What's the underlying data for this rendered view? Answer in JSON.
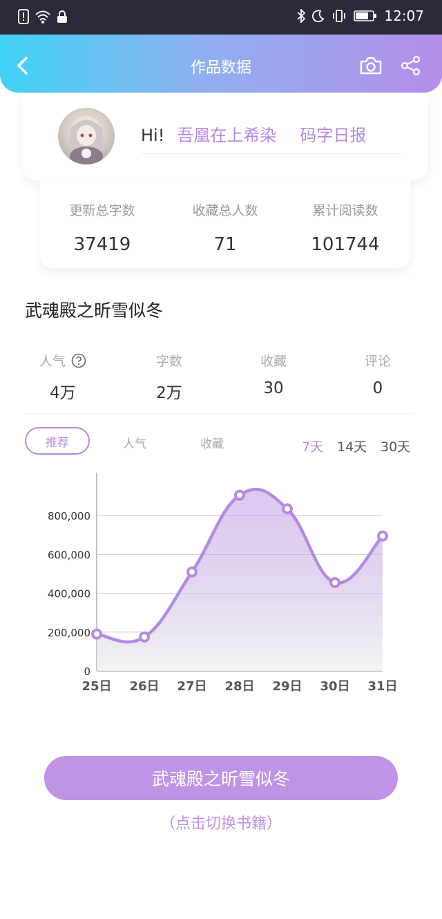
{
  "status_bar": {
    "time": "12:07",
    "icons": [
      "alert-icon",
      "wifi-icon",
      "lock-icon",
      "bluetooth-icon",
      "moon-icon",
      "vibrate-icon",
      "battery-icon"
    ]
  },
  "header": {
    "title": "作品数据",
    "back_icon": "back-icon",
    "camera_icon": "camera-icon",
    "share_icon": "share-icon"
  },
  "profile": {
    "greeting": "Hi!",
    "username": "吾凰在上希染",
    "daily_link": "码字日报"
  },
  "summary_stats": [
    {
      "label": "更新总字数",
      "value": "37419"
    },
    {
      "label": "收藏总人数",
      "value": "71"
    },
    {
      "label": "累计阅读数",
      "value": "101744"
    }
  ],
  "book": {
    "title": "武魂殿之昕雪似冬",
    "metrics": [
      {
        "label": "人气",
        "value": "4万",
        "help_icon": "question-icon"
      },
      {
        "label": "字数",
        "value": "2万"
      },
      {
        "label": "收藏",
        "value": "30"
      },
      {
        "label": "评论",
        "value": "0"
      }
    ]
  },
  "chart_tabs": {
    "tabs": [
      "推荐",
      "人气",
      "收藏"
    ],
    "active_tab": "推荐",
    "ranges": [
      "7天",
      "14天",
      "30天"
    ],
    "active_range": "7天"
  },
  "chart_data": {
    "type": "area",
    "categories": [
      "25日",
      "26日",
      "27日",
      "28日",
      "29日",
      "30日",
      "31日"
    ],
    "values": [
      190000,
      175000,
      510000,
      905000,
      835000,
      455000,
      695000
    ],
    "y_tick_labels": [
      "0",
      "200,000",
      "400,000",
      "600,000",
      "800,000"
    ],
    "ylim": [
      0,
      1000000
    ],
    "grid": true,
    "color": "#b48ae2"
  },
  "footer": {
    "book_button": "武魂殿之昕雪似冬",
    "switch_hint": "（点击切换书籍）"
  },
  "colors": {
    "accent": "#b48ae2",
    "button": "#bf93e5",
    "header_start": "#3fd2f4",
    "header_end": "#b58ee9"
  }
}
